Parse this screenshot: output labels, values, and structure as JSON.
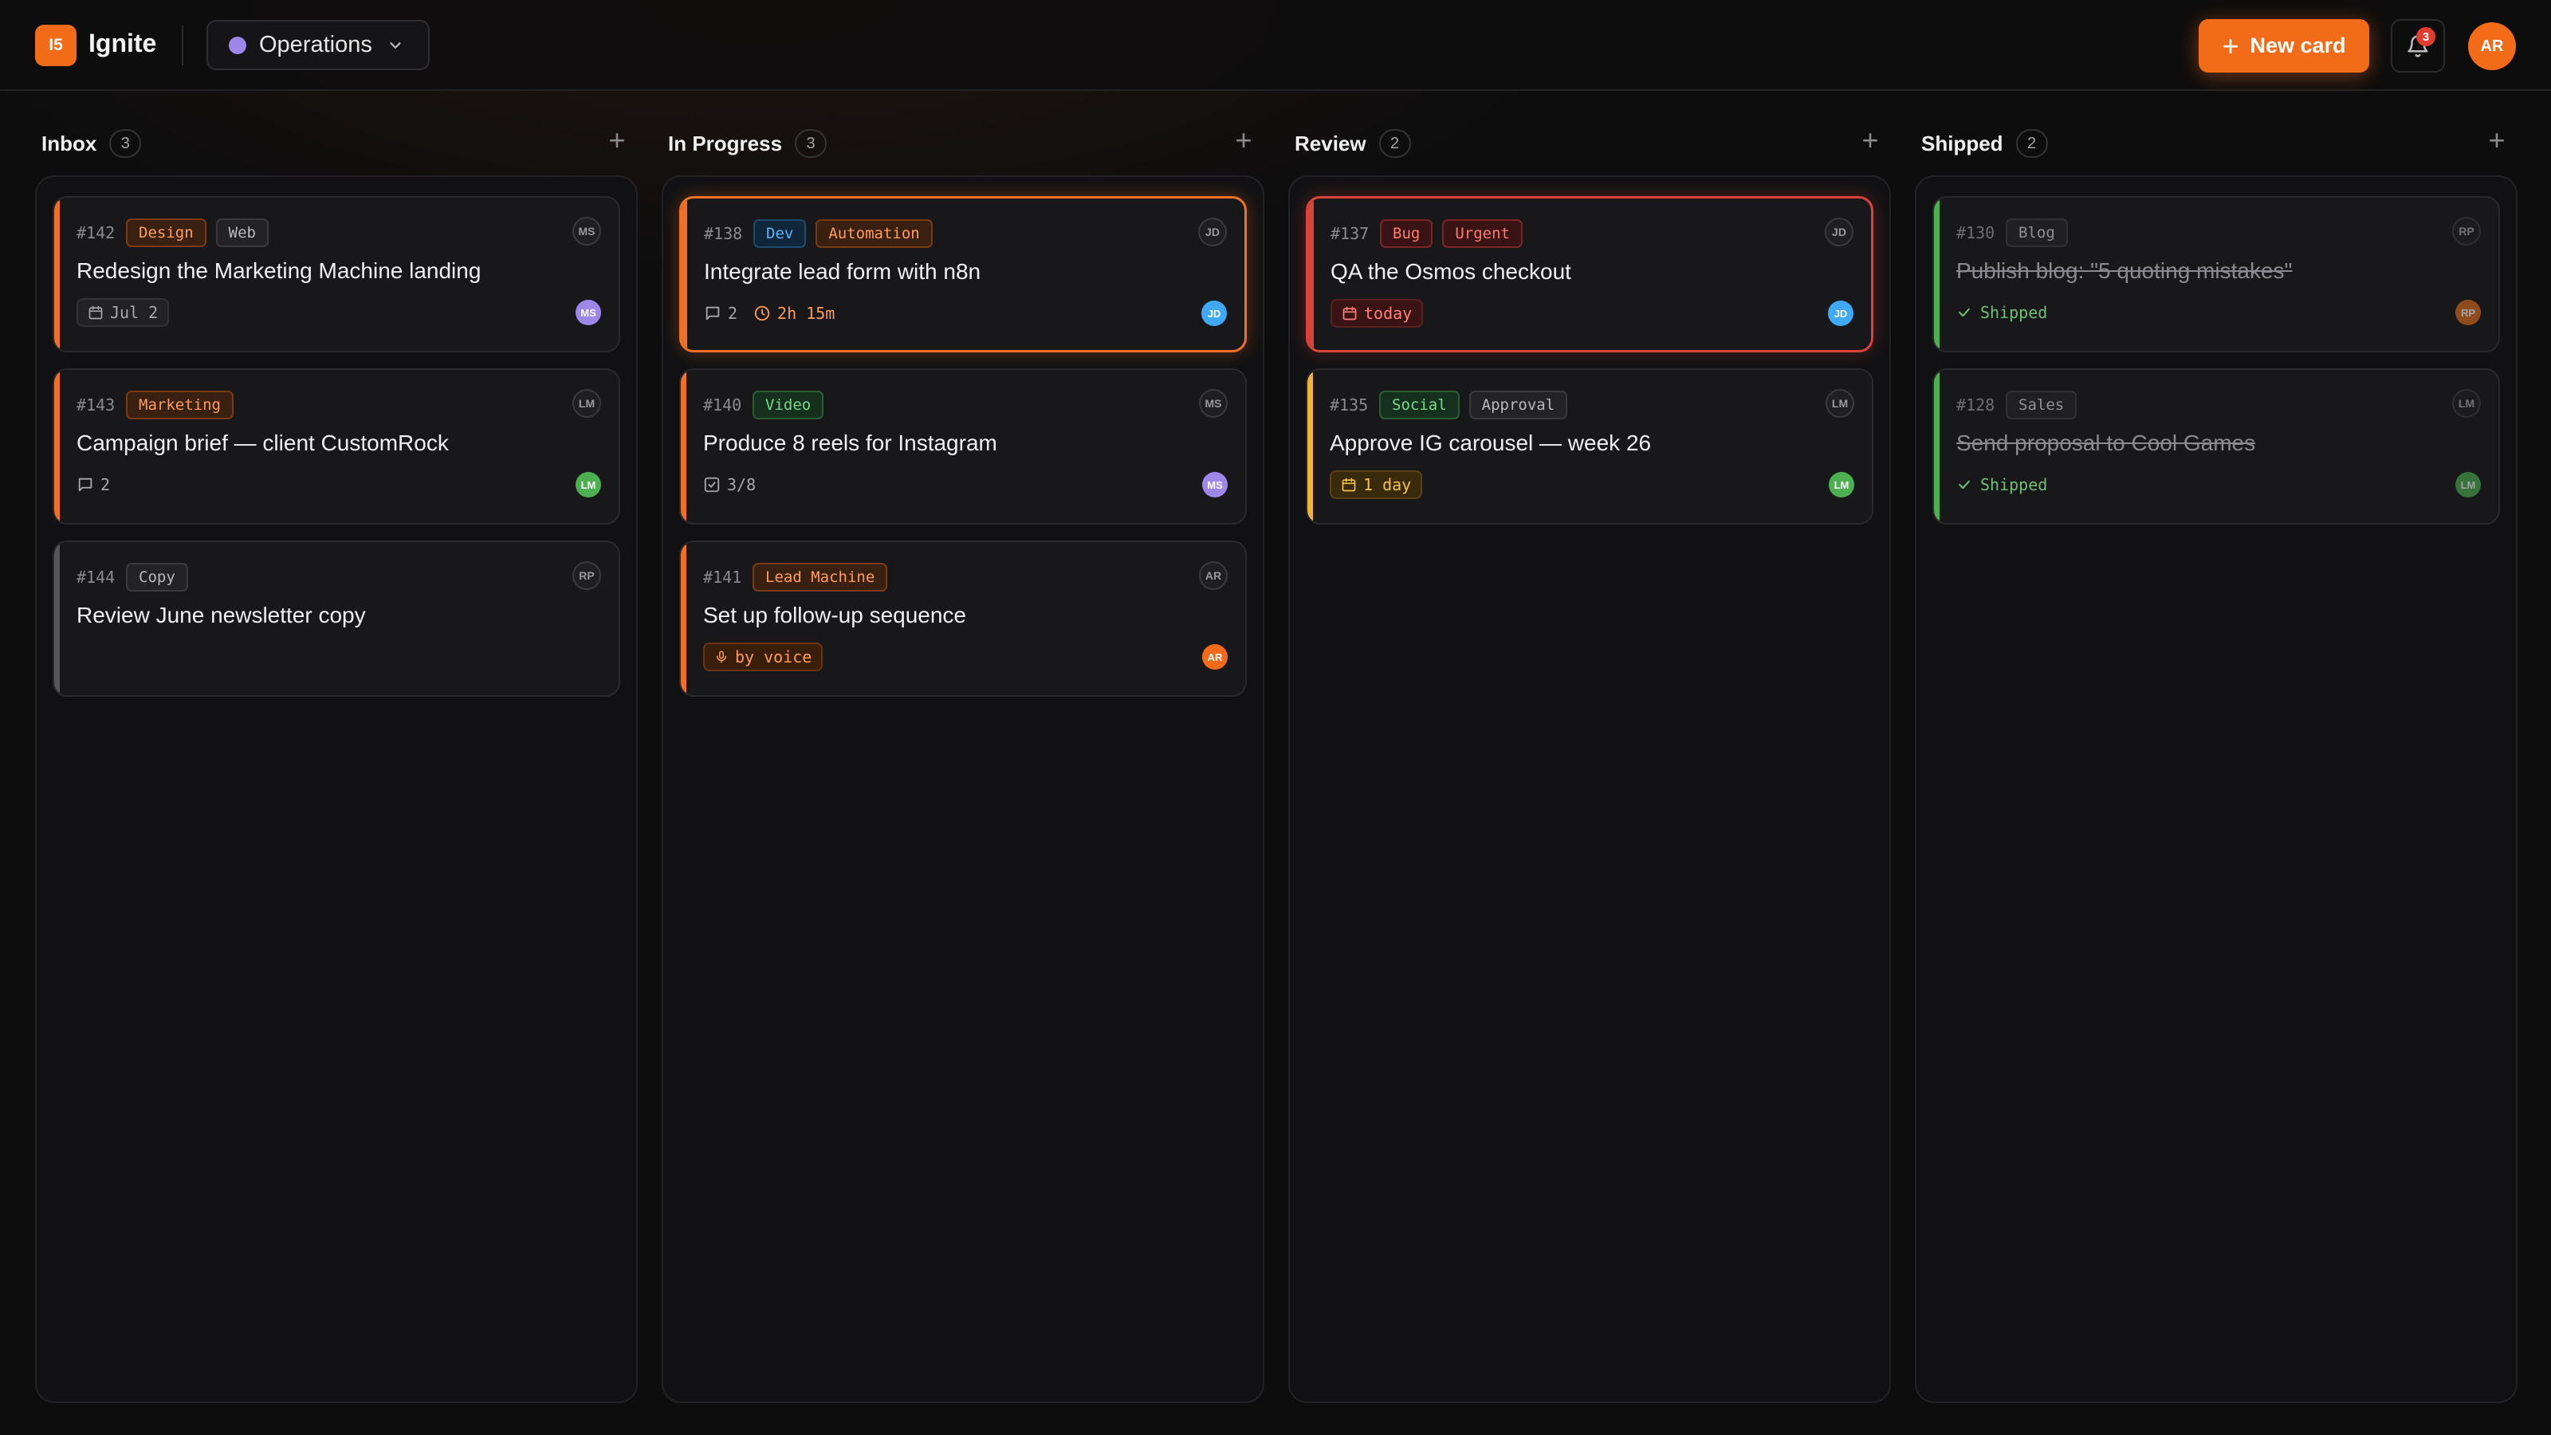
{
  "app": {
    "logo": "I5",
    "title": "Ignite"
  },
  "workspace": {
    "label": "Operations",
    "color": "#9d87e8"
  },
  "header": {
    "new_card": "New card",
    "notifications": "3",
    "user_initials": "AR"
  },
  "colors": {
    "accent": "#f26b18",
    "orange": "#f07126",
    "red": "#d8433a",
    "amber": "#f0b43a",
    "green": "#4caf50",
    "gray": "#55555a"
  },
  "columns": [
    {
      "name": "Inbox",
      "count": "3",
      "cards": [
        {
          "id": "#142",
          "tags": [
            {
              "text": "Design",
              "style": "orange"
            },
            {
              "text": "Web",
              "style": "gray"
            }
          ],
          "avatar": "MS",
          "title": "Redesign the Marketing Machine landing",
          "accent": "orange",
          "due": "Jul 2",
          "assignee": "MS",
          "assignee_color": "#9d87e8"
        },
        {
          "id": "#143",
          "tags": [
            {
              "text": "Marketing",
              "style": "orange"
            }
          ],
          "avatar": "LM",
          "title": "Campaign brief — client CustomRock",
          "accent": "orange",
          "comments": "2",
          "assignee": "LM",
          "assignee_color": "#4caf50"
        },
        {
          "id": "#144",
          "tags": [
            {
              "text": "Copy",
              "style": "gray"
            }
          ],
          "avatar": "RP",
          "title": "Review June newsletter copy",
          "accent": "gray"
        }
      ]
    },
    {
      "name": "In Progress",
      "count": "3",
      "cards": [
        {
          "id": "#138",
          "tags": [
            {
              "text": "Dev",
              "style": "blue"
            },
            {
              "text": "Automation",
              "style": "orange"
            }
          ],
          "avatar": "JD",
          "title": "Integrate lead form with n8n",
          "accent": "orange",
          "selected": "orange",
          "comments": "2",
          "time": "2h 15m",
          "assignee": "JD",
          "assignee_color": "#3fa9f5"
        },
        {
          "id": "#140",
          "tags": [
            {
              "text": "Video",
              "style": "green"
            }
          ],
          "avatar": "MS",
          "title": "Produce 8 reels for Instagram",
          "accent": "orange",
          "checklist": "3/8",
          "assignee": "MS",
          "assignee_color": "#9d87e8"
        },
        {
          "id": "#141",
          "tags": [
            {
              "text": "Lead Machine",
              "style": "orange"
            }
          ],
          "avatar": "AR",
          "title": "Set up follow-up sequence",
          "accent": "orange",
          "voice": "by voice",
          "assignee": "AR",
          "assignee_color": "#f26b18"
        }
      ]
    },
    {
      "name": "Review",
      "count": "2",
      "cards": [
        {
          "id": "#137",
          "tags": [
            {
              "text": "Bug",
              "style": "red"
            },
            {
              "text": "Urgent",
              "style": "red"
            }
          ],
          "avatar": "JD",
          "title": "QA the Osmos checkout",
          "accent": "red",
          "selected": "red",
          "due_badge": "today",
          "due_style": "red",
          "assignee": "JD",
          "assignee_color": "#3fa9f5"
        },
        {
          "id": "#135",
          "tags": [
            {
              "text": "Social",
              "style": "green"
            },
            {
              "text": "Approval",
              "style": "gray"
            }
          ],
          "avatar": "LM",
          "title": "Approve IG carousel — week 26",
          "accent": "amber",
          "due_badge": "1 day",
          "due_style": "amber",
          "assignee": "LM",
          "assignee_color": "#4caf50"
        }
      ]
    },
    {
      "name": "Shipped",
      "count": "2",
      "cards": [
        {
          "id": "#130",
          "tags": [
            {
              "text": "Blog",
              "style": "gray"
            }
          ],
          "avatar": "RP",
          "title": "Publish blog: \"5 quoting mistakes\"",
          "accent": "green",
          "done": true,
          "status": "Shipped",
          "assignee": "RP",
          "assignee_color": "#e0701a"
        },
        {
          "id": "#128",
          "tags": [
            {
              "text": "Sales",
              "style": "gray"
            }
          ],
          "avatar": "LM",
          "title": "Send proposal to Cool Games",
          "accent": "green",
          "done": true,
          "status": "Shipped",
          "assignee": "LM",
          "assignee_color": "#4caf50"
        }
      ]
    }
  ]
}
